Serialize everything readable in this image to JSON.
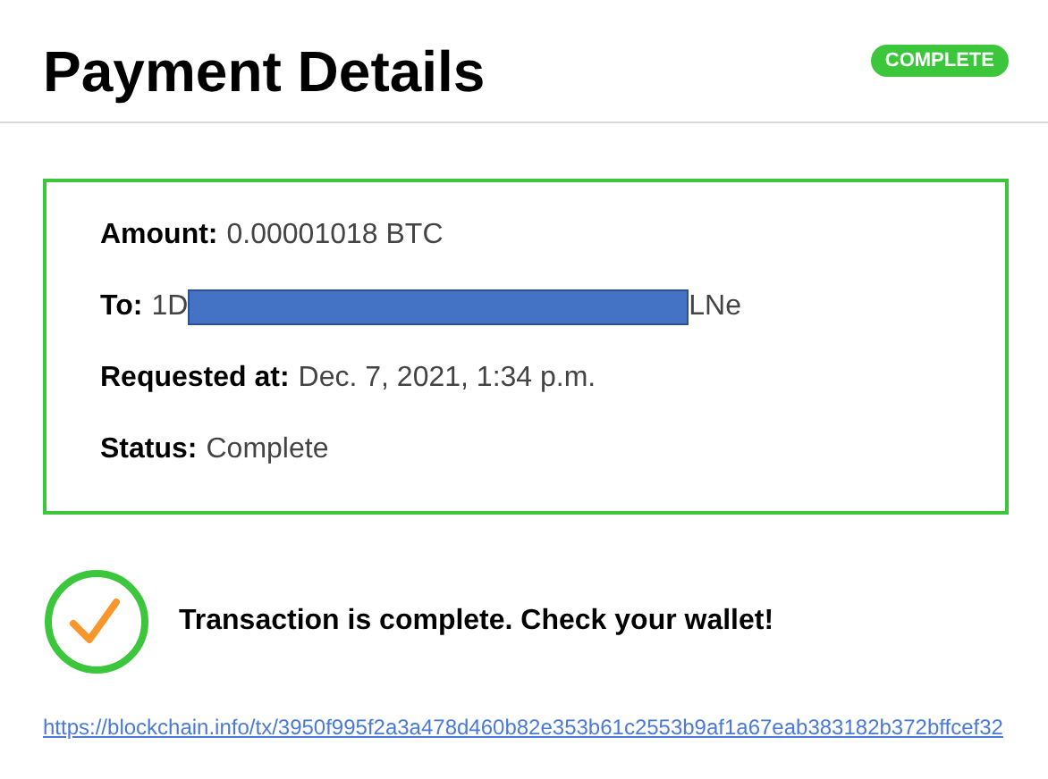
{
  "header": {
    "title": "Payment Details",
    "status_badge": "COMPLETE"
  },
  "details": [
    {
      "kind": "plain",
      "label": "Amount:",
      "value": "0.00001018 BTC"
    },
    {
      "kind": "redacted",
      "label": "To:",
      "value_start": "1D",
      "value_end": "LNe"
    },
    {
      "kind": "plain",
      "label": "Requested at:",
      "value": "Dec. 7, 2021, 1:34 p.m."
    },
    {
      "kind": "plain",
      "label": "Status:",
      "value": "Complete"
    }
  ],
  "result": {
    "complete": true,
    "message": "Transaction is complete. Check your wallet!"
  },
  "link": "https://blockchain.info/tx/3950f995f2a3a478d460b82e353b61c2553b9af1a67eab383182b372bffcef32"
}
